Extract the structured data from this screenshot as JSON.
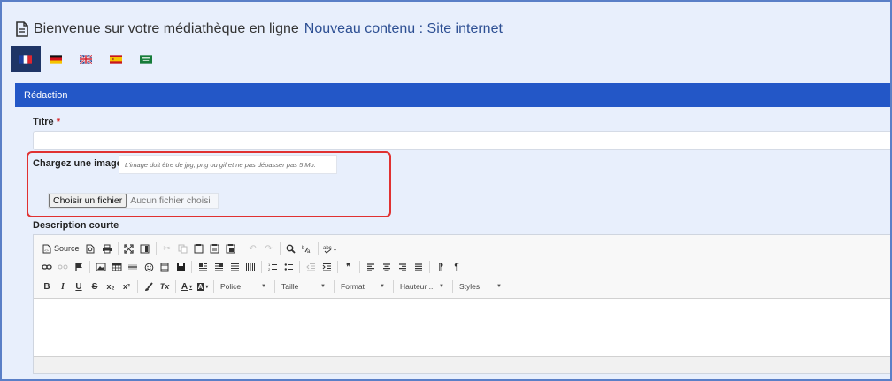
{
  "header": {
    "title_main": "Bienvenue sur votre médiathèque en ligne",
    "title_accent": "Nouveau contenu : Site internet",
    "icon": "document-icon"
  },
  "languages": [
    {
      "code": "fr",
      "icon": "flag-france-icon",
      "active": true
    },
    {
      "code": "de",
      "icon": "flag-germany-icon",
      "active": false
    },
    {
      "code": "en",
      "icon": "flag-uk-icon",
      "active": false
    },
    {
      "code": "es",
      "icon": "flag-spain-icon",
      "active": false
    },
    {
      "code": "ar",
      "icon": "flag-saudi-icon",
      "active": false
    }
  ],
  "section": {
    "label": "Rédaction"
  },
  "form": {
    "title_label": "Titre",
    "required_mark": "*",
    "title_value": "",
    "image_label": "Chargez une image",
    "image_hint": "L'image doit être de jpg, png ou gif et ne pas dépasser pas 5 Mo.",
    "file_button": "Choisir un fichier",
    "file_status": "Aucun fichier choisi",
    "description_label": "Description courte"
  },
  "editor": {
    "source_label": "Source",
    "font_label": "Police",
    "size_label": "Taille",
    "format_label": "Format",
    "height_label": "Hauteur ...",
    "styles_label": "Styles",
    "bold_glyph": "B",
    "italic_glyph": "I",
    "underline_glyph": "U",
    "strike_glyph": "S",
    "subscript_glyph": "x₂",
    "superscript_glyph": "x²",
    "removeformat_glyph": "Tx",
    "textcolor_glyph": "A",
    "bgcolor_glyph": "A",
    "blockquote_glyph": "❞",
    "ltr_glyph": "⁋",
    "rtl_glyph": "¶"
  },
  "colors": {
    "accent": "#2357c7",
    "background": "#e8effc",
    "highlight": "#e03131",
    "title_accent": "#2d4f93"
  }
}
